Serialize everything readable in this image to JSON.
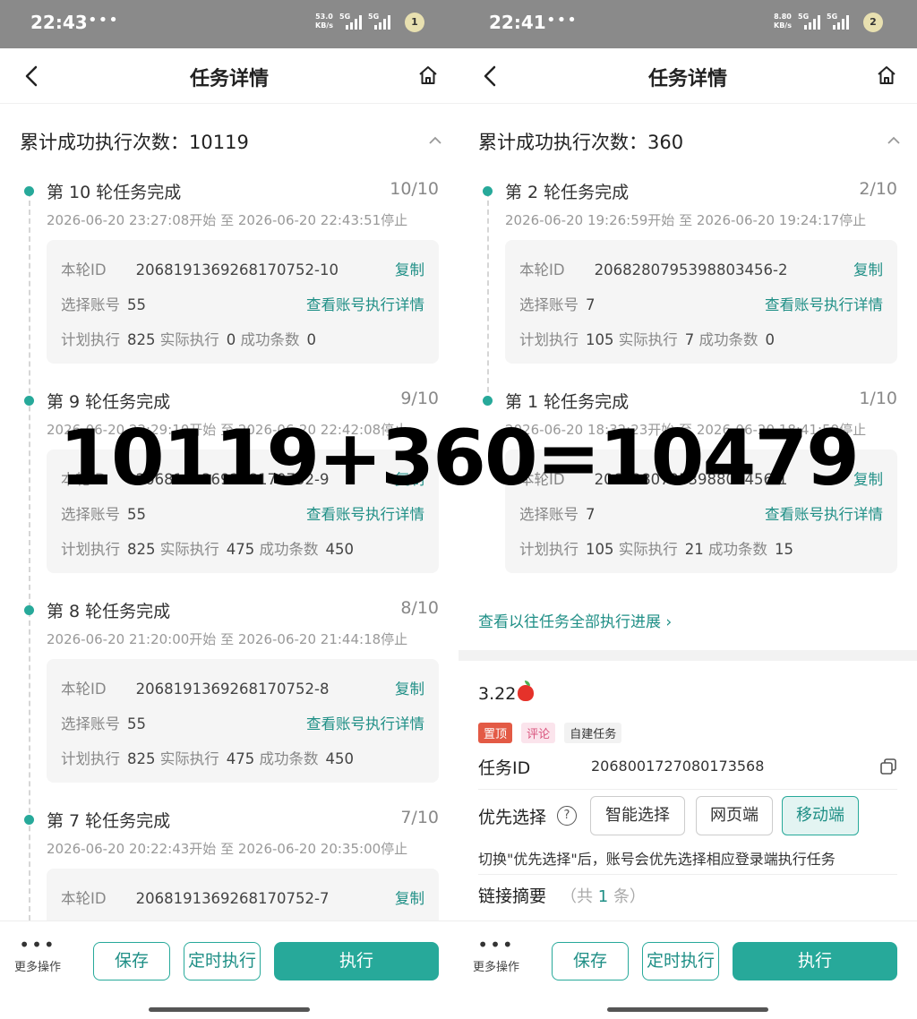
{
  "overlay_text": "10119+360=10479",
  "colors": {
    "accent": "#27a99a",
    "link": "#1f8f86",
    "status_bar": "#8a8a8a"
  },
  "panels": [
    {
      "status": {
        "time": "22:43",
        "dots": "•••",
        "rate_value": "53.0",
        "rate_unit": "KB/s",
        "net1": "5G",
        "net2": "5G",
        "battery": "1"
      },
      "nav": {
        "title": "任务详情",
        "back_icon": "chevron-left-icon",
        "home_icon": "home-icon"
      },
      "summary": "累计成功执行次数：10119",
      "rounds": [
        {
          "title": "第 10 轮任务完成",
          "count": "10/10",
          "time": "2026-06-20 23:27:08开始 至 2026-06-20 22:43:51停止",
          "id_label": "本轮ID",
          "id": "2068191369268170752-10",
          "copy": "复制",
          "acc_label": "选择账号",
          "acc": "55",
          "detail": "查看账号执行详情",
          "plan_label": "计划执行",
          "plan": "825",
          "actual_label": "实际执行",
          "actual": "0",
          "succ_label": "成功条数",
          "succ": "0"
        },
        {
          "title": "第 9 轮任务完成",
          "count": "9/10",
          "time": "2026-06-20 22:29:10开始 至 2026-06-20 22:42:08停止",
          "id_label": "本轮ID",
          "id": "2068191369268170752-9",
          "copy": "复制",
          "acc_label": "选择账号",
          "acc": "55",
          "detail": "查看账号执行详情",
          "plan_label": "计划执行",
          "plan": "825",
          "actual_label": "实际执行",
          "actual": "475",
          "succ_label": "成功条数",
          "succ": "450"
        },
        {
          "title": "第 8 轮任务完成",
          "count": "8/10",
          "time": "2026-06-20 21:20:00开始 至 2026-06-20 21:44:18停止",
          "id_label": "本轮ID",
          "id": "2068191369268170752-8",
          "copy": "复制",
          "acc_label": "选择账号",
          "acc": "55",
          "detail": "查看账号执行详情",
          "plan_label": "计划执行",
          "plan": "825",
          "actual_label": "实际执行",
          "actual": "475",
          "succ_label": "成功条数",
          "succ": "450"
        },
        {
          "title": "第 7 轮任务完成",
          "count": "7/10",
          "time": "2026-06-20 20:22:43开始 至 2026-06-20 20:35:00停止",
          "id_label": "本轮ID",
          "id": "2068191369268170752-7",
          "copy": "复制",
          "acc_label": "",
          "acc": "",
          "detail": "",
          "plan_label": "",
          "plan": "",
          "actual_label": "",
          "actual": "",
          "succ_label": "",
          "succ": ""
        }
      ],
      "bottom": {
        "more_dots": "•••",
        "more": "更多操作",
        "save": "保存",
        "timer": "定时执行",
        "run": "执行"
      }
    },
    {
      "status": {
        "time": "22:41",
        "dots": "•••",
        "rate_value": "8.80",
        "rate_unit": "KB/s",
        "net1": "5G",
        "net2": "5G",
        "battery": "2"
      },
      "nav": {
        "title": "任务详情",
        "back_icon": "chevron-left-icon",
        "home_icon": "home-icon"
      },
      "summary": "累计成功执行次数：360",
      "rounds": [
        {
          "title": "第 2 轮任务完成",
          "count": "2/10",
          "time": "2026-06-20 19:26:59开始 至 2026-06-20 19:24:17停止",
          "id_label": "本轮ID",
          "id": "2068280795398803456-2",
          "copy": "复制",
          "acc_label": "选择账号",
          "acc": "7",
          "detail": "查看账号执行详情",
          "plan_label": "计划执行",
          "plan": "105",
          "actual_label": "实际执行",
          "actual": "7",
          "succ_label": "成功条数",
          "succ": "0"
        },
        {
          "title": "第 1 轮任务完成",
          "count": "1/10",
          "time": "2026-06-20 18:32:23开始 至 2026-06-20 18:41:59停止",
          "id_label": "本轮ID",
          "id": "2068280795398803456-1",
          "copy": "复制",
          "acc_label": "选择账号",
          "acc": "7",
          "detail": "查看账号执行详情",
          "plan_label": "计划执行",
          "plan": "105",
          "actual_label": "实际执行",
          "actual": "21",
          "succ_label": "成功条数",
          "succ": "15"
        }
      ],
      "more_link": "查看以往任务全部执行进展 ›",
      "task": {
        "name": "3.22",
        "tags": [
          "置顶",
          "评论",
          "自建任务"
        ],
        "id_label": "任务ID",
        "id": "2068001727080173568",
        "priority_label": "优先选择",
        "priority_help": "?",
        "options": [
          "智能选择",
          "网页端",
          "移动端"
        ],
        "selected_option": "移动端",
        "priority_note": "切换\"优先选择\"后，账号会优先选择相应登录端执行任务",
        "link_summary": "链接摘要",
        "link_count_pre": "（共",
        "link_count": "1",
        "link_count_post": "条）"
      },
      "bottom": {
        "more_dots": "•••",
        "more": "更多操作",
        "save": "保存",
        "timer": "定时执行",
        "run": "执行"
      }
    }
  ]
}
